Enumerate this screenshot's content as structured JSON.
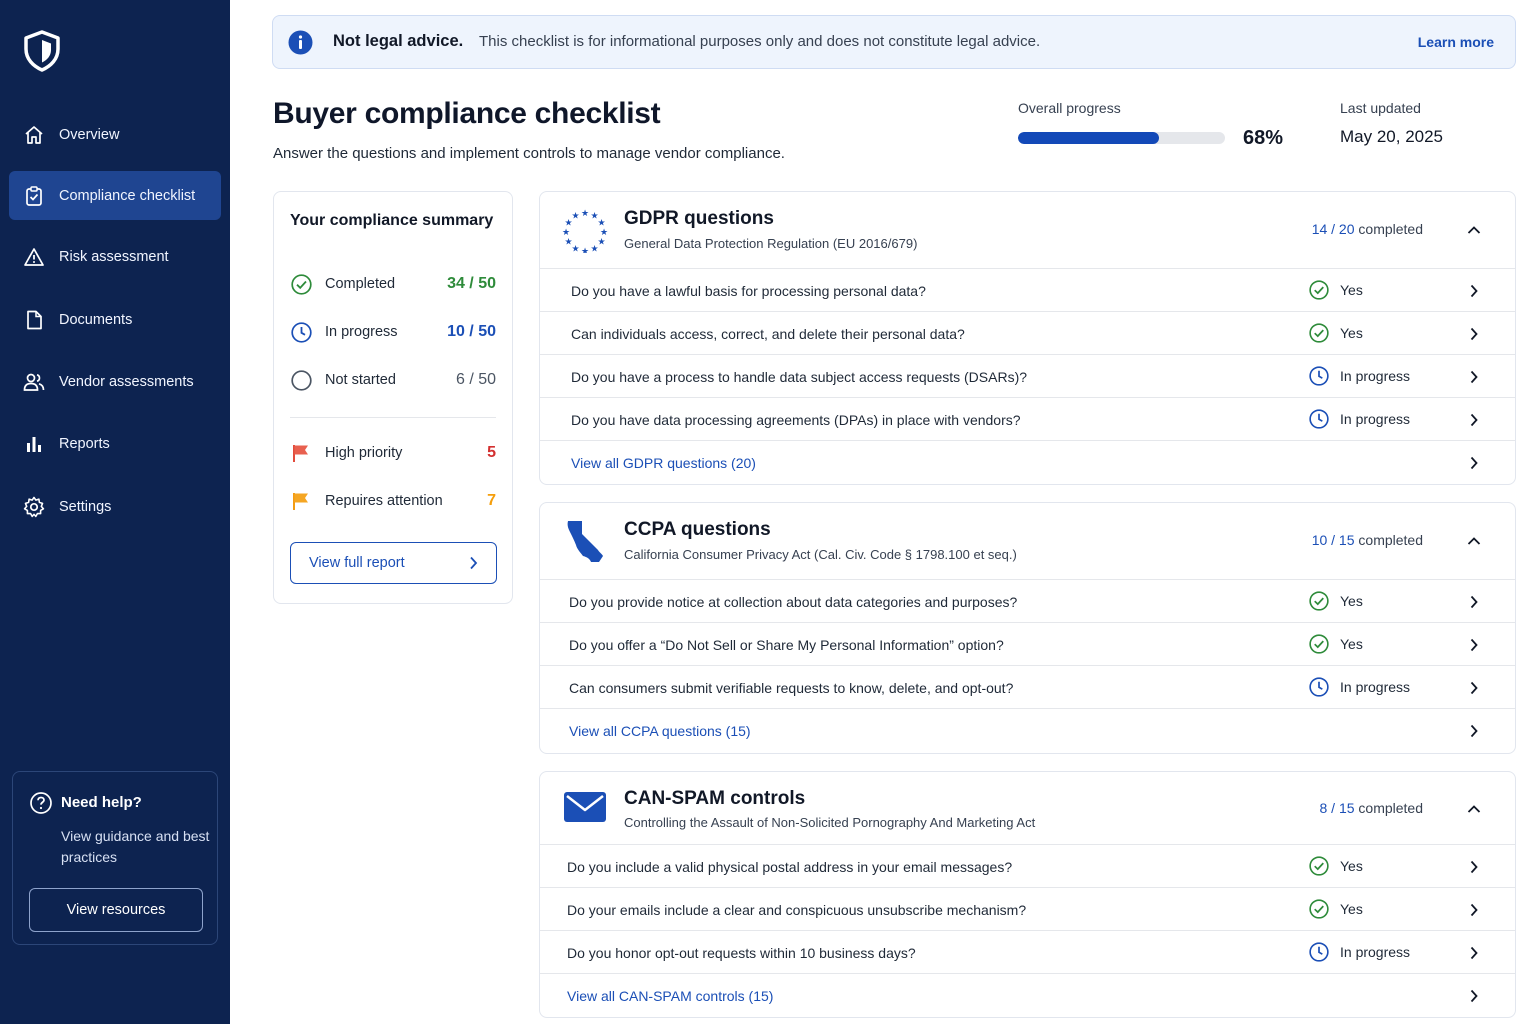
{
  "sidebar": {
    "items": [
      {
        "label": "Overview",
        "icon": "home-icon"
      },
      {
        "label": "Compliance checklist",
        "icon": "clipboard-check-icon",
        "active": true
      },
      {
        "label": "Risk assessment",
        "icon": "warning-icon"
      },
      {
        "label": "Documents",
        "icon": "document-icon"
      },
      {
        "label": "Vendor assessments",
        "icon": "users-icon"
      },
      {
        "label": "Reports",
        "icon": "bar-chart-icon"
      },
      {
        "label": "Settings",
        "icon": "gear-icon"
      }
    ],
    "help": {
      "title": "Need help?",
      "text": "View guidance and best practices",
      "button": "View resources"
    }
  },
  "banner": {
    "title": "Not legal advice.",
    "text": "This checklist is for informational purposes only and does not constitute legal advice.",
    "link": "Learn more"
  },
  "header": {
    "title": "Buyer compliance checklist",
    "subtitle": "Answer the questions and implement controls to manage vendor compliance.",
    "progress_label": "Overall progress",
    "progress_value": "68%",
    "progress_fraction": 0.68,
    "updated_label": "Last updated",
    "updated_value": "May 20, 2025"
  },
  "summary": {
    "title": "Your compliance summary",
    "rows": [
      {
        "label": "Completed",
        "value": "34 / 50",
        "color": "#2e8b3a",
        "icon": "check-circle-icon"
      },
      {
        "label": "In progress",
        "value": "10 / 50",
        "color": "#1b4fb6",
        "icon": "clock-icon"
      },
      {
        "label": "Not started",
        "value": "6 / 50",
        "color": "#4b5563",
        "icon": "empty-circle-icon"
      },
      {
        "label": "High priority",
        "value": "5",
        "color": "#d32f2f",
        "icon": "red-flag-icon"
      },
      {
        "label": "Repuires attention",
        "value": "7",
        "color": "#f59e0b",
        "icon": "orange-flag-icon"
      }
    ],
    "button": "View full report"
  },
  "sections": [
    {
      "title": "GDPR questions",
      "subtitle": "General Data Protection Regulation (EU 2016/679)",
      "count_num": "14 / 20",
      "count_word": "completed",
      "icon": "eu-stars-icon",
      "questions": [
        {
          "text": "Do you have a lawful basis for processing personal data?",
          "status": "Yes"
        },
        {
          "text": "Can individuals access, correct, and delete their personal data?",
          "status": "Yes"
        },
        {
          "text": "Do you have a process to handle data subject access requests (DSARs)?",
          "status": "In progress"
        },
        {
          "text": "Do you have data processing agreements (DPAs) in place with vendors?",
          "status": "In progress"
        }
      ],
      "view_all": "View all GDPR questions (20)"
    },
    {
      "title": "CCPA questions",
      "subtitle": "California Consumer Privacy Act (Cal. Civ. Code § 1798.100 et seq.)",
      "count_num": "10 / 15",
      "count_word": "completed",
      "icon": "california-map-icon",
      "questions": [
        {
          "text": "Do you provide notice at collection about data categories and purposes?",
          "status": "Yes"
        },
        {
          "text": "Do you offer a “Do Not Sell or Share My Personal Information” option?",
          "status": "Yes"
        },
        {
          "text": "Can consumers submit verifiable requests to know, delete, and opt-out?",
          "status": "In progress"
        }
      ],
      "view_all": "View all CCPA questions (15)"
    },
    {
      "title": "CAN-SPAM controls",
      "subtitle": "Controlling the Assault of Non-Solicited Pornography And Marketing Act",
      "count_num": "8 / 15",
      "count_word": "completed",
      "icon": "envelope-icon",
      "questions": [
        {
          "text": "Do you include a valid physical postal address in your email messages?",
          "status": "Yes"
        },
        {
          "text": "Do your emails include a clear and conspicuous unsubscribe mechanism?",
          "status": "Yes"
        },
        {
          "text": "Do you honor opt-out requests within 10 business days?",
          "status": "In progress"
        }
      ],
      "view_all": "View all CAN-SPAM controls (15)"
    }
  ],
  "colors": {
    "sidebar": "#0d2350",
    "accent": "#1b4fb6",
    "success": "#2e8b3a"
  }
}
